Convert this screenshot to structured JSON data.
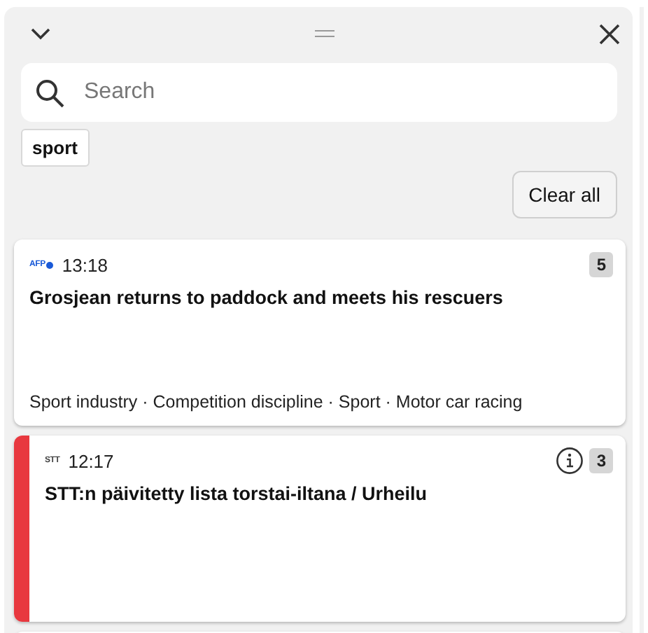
{
  "search": {
    "placeholder": "Search"
  },
  "filters": [
    {
      "label": "sport"
    }
  ],
  "clear_button": "Clear all",
  "items": [
    {
      "source": "AFP",
      "color": "#1a5ad8",
      "logo_dot": true,
      "time": "13:18",
      "headline": "Grosjean returns to paddock and meets his rescuers",
      "subjects": "Sport industry · Competition discipline · Sport · Motor car racing",
      "count": "5",
      "info": false,
      "urgent": false
    },
    {
      "source": "STT",
      "color": "#444444",
      "logo_dot": false,
      "time": "12:17",
      "headline": "STT:n päivitetty lista torstai-iltana / Urheilu",
      "count": "3",
      "info": true,
      "urgent": true
    }
  ]
}
